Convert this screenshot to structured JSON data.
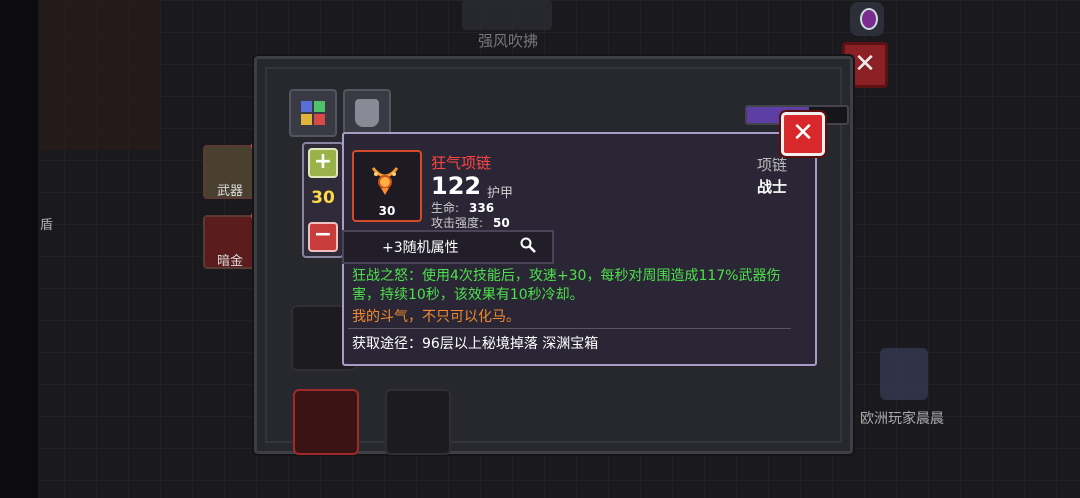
{
  "background": {
    "banner_text": "强风吹拂",
    "side_buttons": [
      {
        "label": "武器"
      },
      {
        "label": "暗金"
      }
    ],
    "side_fragment": "盾",
    "player_name": "欧洲玩家晨晨"
  },
  "inventory": {
    "xp": {
      "current": 42,
      "max": 68,
      "text": "42/68"
    }
  },
  "tooltip": {
    "item_name": "狂气项链",
    "item_level": "30",
    "main_value": "122",
    "main_value_label": "护甲",
    "stats": [
      {
        "label": "生命:",
        "value": "336"
      },
      {
        "label": "攻击强度:",
        "value": "50"
      }
    ],
    "item_type": "项链",
    "item_class": "战士",
    "random_attr": "+3随机属性",
    "skill_desc": "狂战之怒：使用4次技能后，攻速+30，每秒对周围造成117%武器伤害，持续10秒，该效果有10秒冷却。",
    "flavor": "我的斗气，不只可以化马。",
    "source": "获取途径：96层以上秘境掉落 深渊宝箱"
  },
  "quantity": {
    "value": "30"
  },
  "colors": {
    "item_name": "#ff4444",
    "skill": "#4ce04a",
    "flavor": "#f08a2c",
    "quantity": "#ffd84a",
    "close": "#d8282c"
  },
  "icons": [
    "close-icon",
    "plus-icon",
    "minus-icon",
    "magnifier-icon",
    "necklace-icon",
    "gem-icon",
    "grid-tab-icon",
    "armor-tab-icon"
  ]
}
